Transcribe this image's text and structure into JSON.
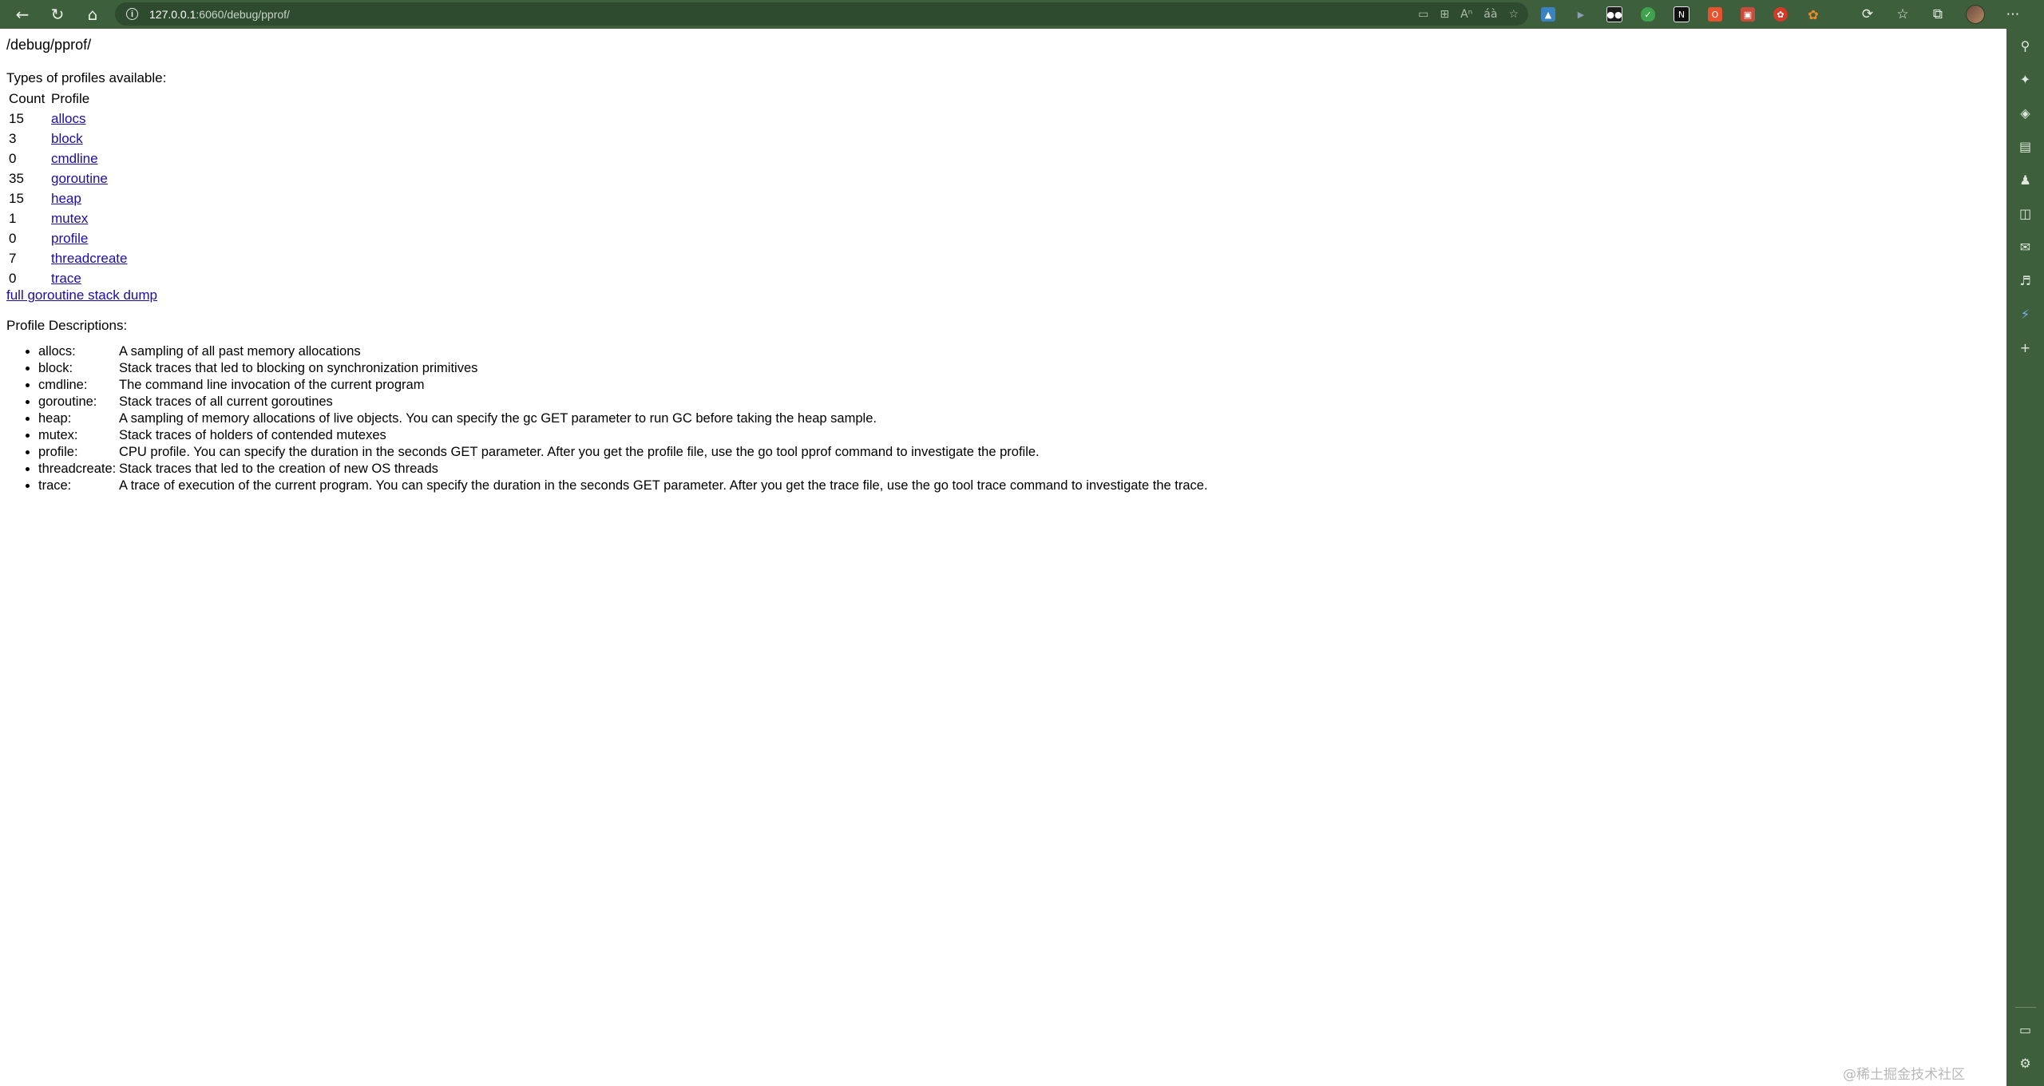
{
  "browser": {
    "url_host": "127.0.0.1",
    "url_rest": ":6060/debug/pprof/",
    "toolbar_icons": [
      "back-icon",
      "refresh-icon",
      "home-icon"
    ],
    "address_actions": [
      "read-aloud-icon",
      "app-available-icon",
      "immersive-reader-icon",
      "translate-icon",
      "add-favorite-icon"
    ],
    "extensions": [
      "image-extension-icon",
      "play-extension-icon",
      "tampermonkey-icon",
      "adguard-icon",
      "notion-icon",
      "office-extension-icon",
      "screenshot-extension-icon",
      "red-extension-icon",
      "orange-extension-icon"
    ],
    "right_icons": [
      "refresh-sync-icon",
      "favorites-icon",
      "collections-icon",
      "profile-avatar",
      "more-menu-icon"
    ]
  },
  "sidebar": {
    "icons": [
      "search-icon",
      "discover-icon",
      "shopping-icon",
      "tools-icon",
      "games-icon",
      "office-icon",
      "outlook-icon",
      "notification-icon",
      "copilot-icon",
      "add-icon"
    ],
    "bottom_icons": [
      "sidebar-toggle-icon",
      "settings-icon"
    ]
  },
  "page": {
    "title": "/debug/pprof/",
    "types_label": "Types of profiles available:",
    "table_headers": {
      "count": "Count",
      "profile": "Profile"
    },
    "profiles": [
      {
        "count": "15",
        "name": "allocs"
      },
      {
        "count": "3",
        "name": "block"
      },
      {
        "count": "0",
        "name": "cmdline"
      },
      {
        "count": "35",
        "name": "goroutine"
      },
      {
        "count": "15",
        "name": "heap"
      },
      {
        "count": "1",
        "name": "mutex"
      },
      {
        "count": "0",
        "name": "profile"
      },
      {
        "count": "7",
        "name": "threadcreate"
      },
      {
        "count": "0",
        "name": "trace"
      }
    ],
    "full_dump_link": "full goroutine stack dump",
    "descriptions_label": "Profile Descriptions:",
    "descriptions": [
      {
        "name": "allocs:",
        "text": "A sampling of all past memory allocations"
      },
      {
        "name": "block:",
        "text": "Stack traces that led to blocking on synchronization primitives"
      },
      {
        "name": "cmdline:",
        "text": "The command line invocation of the current program"
      },
      {
        "name": "goroutine:",
        "text": "Stack traces of all current goroutines"
      },
      {
        "name": "heap:",
        "text": "A sampling of memory allocations of live objects. You can specify the gc GET parameter to run GC before taking the heap sample."
      },
      {
        "name": "mutex:",
        "text": "Stack traces of holders of contended mutexes"
      },
      {
        "name": "profile:",
        "text": "CPU profile. You can specify the duration in the seconds GET parameter. After you get the profile file, use the go tool pprof command to investigate the profile."
      },
      {
        "name": "threadcreate:",
        "text": "Stack traces that led to the creation of new OS threads"
      },
      {
        "name": "trace:",
        "text": "A trace of execution of the current program. You can specify the duration in the seconds GET parameter. After you get the trace file, use the go tool trace command to investigate the trace."
      }
    ]
  },
  "watermark": "@稀土掘金技术社区"
}
